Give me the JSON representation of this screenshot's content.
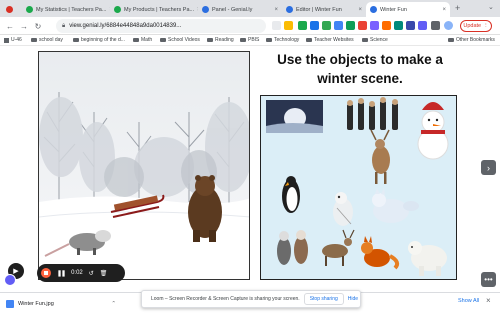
{
  "browser": {
    "tabs": [
      {
        "label": "My Statistics | Teachers Pa...",
        "color": "#1ba94c"
      },
      {
        "label": "My Products | Teachers Pa...",
        "color": "#1ba94c"
      },
      {
        "label": "Panel - Genial.ly",
        "color": "#2b6ee0"
      },
      {
        "label": "Editor | Winter Fun",
        "color": "#2b6ee0"
      },
      {
        "label": "Winter Fun",
        "color": "#2b6ee0"
      }
    ],
    "new_tab": "+",
    "url": "view.genial.ly/6884e44848a9da0014839...",
    "update_label": "Update"
  },
  "bookmarks": {
    "apps_label": "U-46",
    "items": [
      "school day",
      "beginning of the d...",
      "Math",
      "School Videos",
      "Reading",
      "PBIS",
      "Technology",
      "Teacher Websites",
      "Science"
    ],
    "other": "Other Bookmarks"
  },
  "slide": {
    "title": "Use the objects to make a winter scene."
  },
  "loom": {
    "timer": "0:02"
  },
  "download": {
    "filename": "Winter Fun.jpg",
    "show_all": "Show All"
  },
  "share_banner": {
    "message": "Loom – Screen Recorder & Screen Capture is sharing your screen.",
    "stop_label": "Stop sharing",
    "hide_label": "Hide"
  }
}
